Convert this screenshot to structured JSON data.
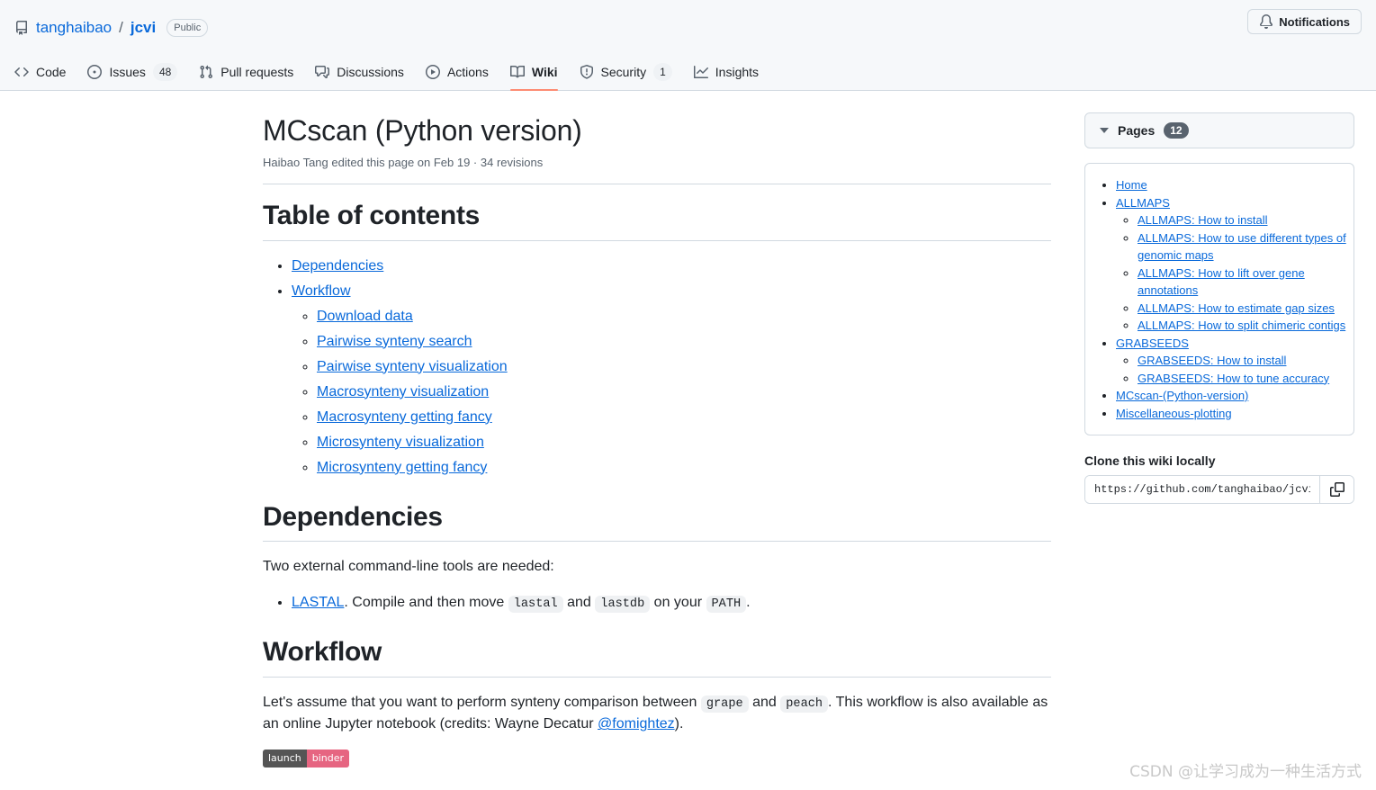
{
  "header": {
    "repo_icon": "repo-book-icon",
    "owner": "tanghaibao",
    "separator": "/",
    "name": "jcvi",
    "visibility": "Public",
    "notifications_label": "Notifications",
    "notifications_icon": "bell-icon"
  },
  "nav": {
    "tabs": [
      {
        "label": "Code",
        "icon": "code-icon",
        "count": null,
        "active": false
      },
      {
        "label": "Issues",
        "icon": "issue-opened-icon",
        "count": "48",
        "active": false
      },
      {
        "label": "Pull requests",
        "icon": "git-pull-request-icon",
        "count": null,
        "active": false
      },
      {
        "label": "Discussions",
        "icon": "comment-discussion-icon",
        "count": null,
        "active": false
      },
      {
        "label": "Actions",
        "icon": "play-icon",
        "count": null,
        "active": false
      },
      {
        "label": "Wiki",
        "icon": "book-icon",
        "count": null,
        "active": true
      },
      {
        "label": "Security",
        "icon": "shield-icon",
        "count": "1",
        "active": false
      },
      {
        "label": "Insights",
        "icon": "graph-icon",
        "count": null,
        "active": false
      }
    ]
  },
  "wiki": {
    "title": "MCscan (Python version)",
    "byline": "Haibao Tang edited this page on Feb 19 · 34 revisions",
    "toc_heading": "Table of contents",
    "toc": [
      {
        "label": "Dependencies",
        "children": []
      },
      {
        "label": "Workflow",
        "children": [
          "Download data",
          "Pairwise synteny search",
          "Pairwise synteny visualization",
          "Macrosynteny visualization",
          "Macrosynteny getting fancy",
          "Microsynteny visualization",
          "Microsynteny getting fancy"
        ]
      }
    ],
    "dependencies": {
      "heading": "Dependencies",
      "intro": "Two external command-line tools are needed:",
      "item": {
        "link": "LASTAL",
        "text_1": ". Compile and then move ",
        "code_1": "lastal",
        "text_2": " and ",
        "code_2": "lastdb",
        "text_3": " on your ",
        "code_3": "PATH",
        "text_4": "."
      }
    },
    "workflow": {
      "heading": "Workflow",
      "text_1": "Let's assume that you want to perform synteny comparison between ",
      "code_1": "grape",
      "text_2": " and ",
      "code_2": "peach",
      "text_3": ". This workflow is also available as an online Jupyter notebook (credits: Wayne Decatur ",
      "link": "@fomightez",
      "text_4": ").",
      "binder_left": "launch",
      "binder_right": "binder"
    }
  },
  "sidebar": {
    "pages_label": "Pages",
    "pages_count": "12",
    "pages": [
      {
        "label": "Home",
        "children": []
      },
      {
        "label": "ALLMAPS",
        "children": [
          "ALLMAPS: How to install",
          "ALLMAPS: How to use different types of genomic maps",
          "ALLMAPS: How to lift over gene annotations",
          "ALLMAPS: How to estimate gap sizes",
          "ALLMAPS: How to split chimeric contigs"
        ]
      },
      {
        "label": "GRABSEEDS",
        "children": [
          "GRABSEEDS: How to install",
          "GRABSEEDS: How to tune accuracy"
        ]
      },
      {
        "label": "MCscan-(Python-version)",
        "children": []
      },
      {
        "label": "Miscellaneous-plotting",
        "children": []
      }
    ],
    "clone_title": "Clone this wiki locally",
    "clone_url": "https://github.com/tanghaibao/jcvi.w",
    "copy_icon": "copy-icon"
  },
  "watermark": "CSDN @让学习成为一种生活方式",
  "colors": {
    "accent": "#0969da",
    "active_tab_underline": "#fd8c73",
    "header_bg": "#f6f8fa",
    "border": "#d1d9e0",
    "binder_left_bg": "#555555",
    "binder_right_bg": "#e66581",
    "pages_badge_bg": "#59636e"
  }
}
